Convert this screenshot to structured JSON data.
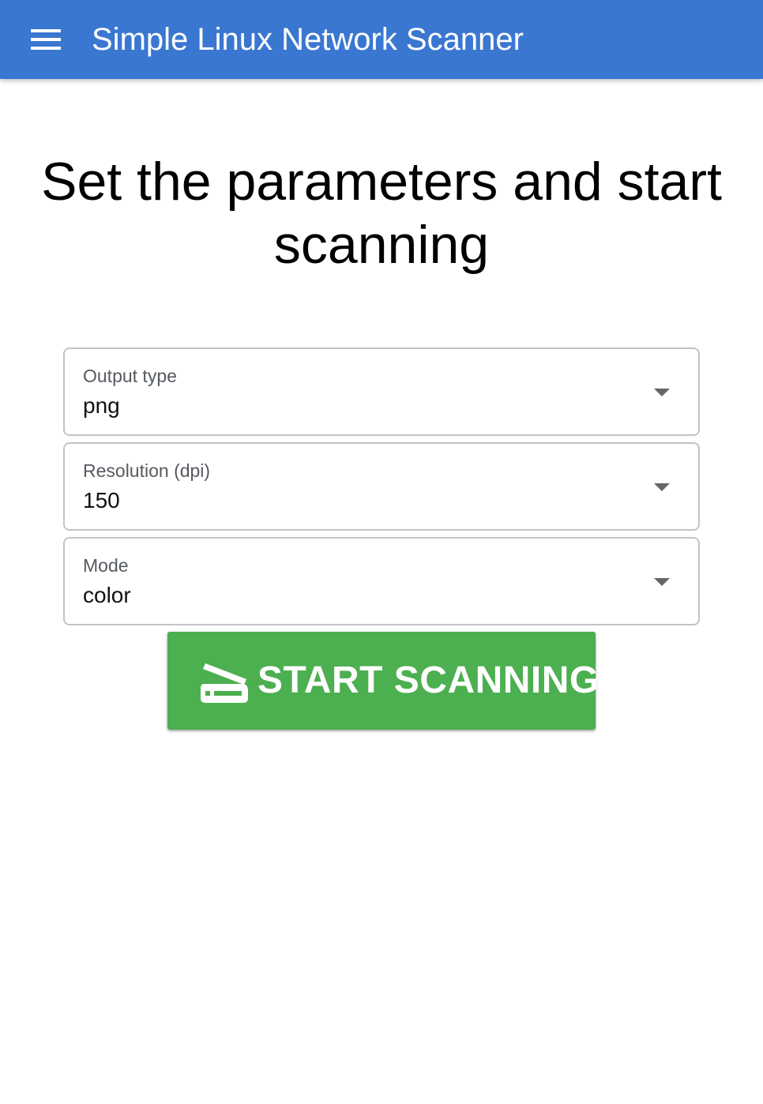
{
  "appbar": {
    "menu_icon": "menu-icon",
    "title": "Simple Linux Network Scanner",
    "color": "#3a77d1"
  },
  "page": {
    "heading": "Set the parameters and start scanning"
  },
  "form": {
    "output_type": {
      "label": "Output type",
      "value": "png"
    },
    "resolution": {
      "label": "Resolution (dpi)",
      "value": "150"
    },
    "mode": {
      "label": "Mode",
      "value": "color"
    }
  },
  "start_button": {
    "label": "START SCANNING",
    "icon": "scanner-icon",
    "color": "#4caf50"
  }
}
